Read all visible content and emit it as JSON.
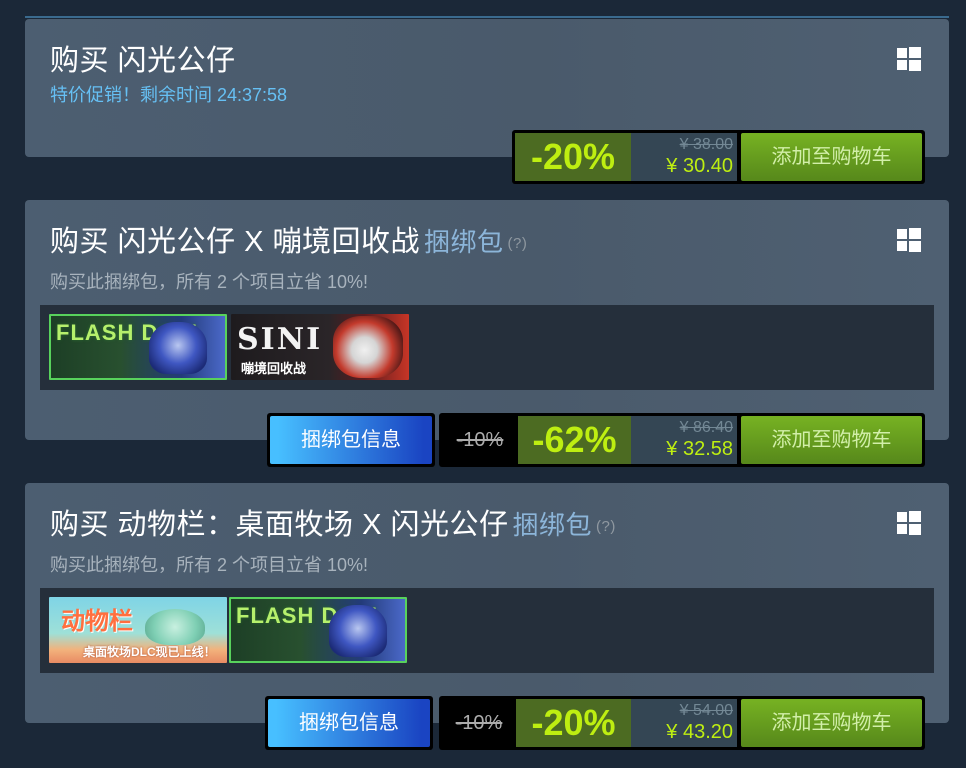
{
  "game": {
    "title": "购买 闪光公仔",
    "sale_text": "特价促销！剩余时间 24:37:58",
    "discount": "-20%",
    "original_price": "¥ 38.00",
    "final_price": "¥ 30.40",
    "cart_label": "添加至购物车",
    "platform_icon": "windows-icon"
  },
  "bundles": [
    {
      "title": "购买 闪光公仔 X 嘣境回收战",
      "tag": "捆绑包",
      "help": "(?)",
      "description": "购买此捆绑包，所有 2 个项目立省 10%!",
      "items": [
        {
          "caption": "FLASH DOLL"
        },
        {
          "caption": "SINI",
          "subcaption": "嘣境回收战"
        }
      ],
      "info_label": "捆绑包信息",
      "bundle_discount": "-10%",
      "discount": "-62%",
      "original_price": "¥ 86.40",
      "final_price": "¥ 32.58",
      "cart_label": "添加至购物车"
    },
    {
      "title": "购买 动物栏：桌面牧场 X 闪光公仔",
      "tag": "捆绑包",
      "help": "(?)",
      "description": "购买此捆绑包，所有 2 个项目立省 10%!",
      "items": [
        {
          "caption": "动物栏",
          "subcaption": "桌面牧场DLC现已上线！"
        },
        {
          "caption": "FLASH DOLL"
        }
      ],
      "info_label": "捆绑包信息",
      "bundle_discount": "-10%",
      "discount": "-20%",
      "original_price": "¥ 54.00",
      "final_price": "¥ 43.20",
      "cart_label": "添加至购物车"
    }
  ],
  "colors": {
    "background": "#1b2838",
    "discount_green": "#beee11",
    "cart_green": "#75b022",
    "info_blue": "#47bfff",
    "link_blue": "#66c0f4"
  }
}
